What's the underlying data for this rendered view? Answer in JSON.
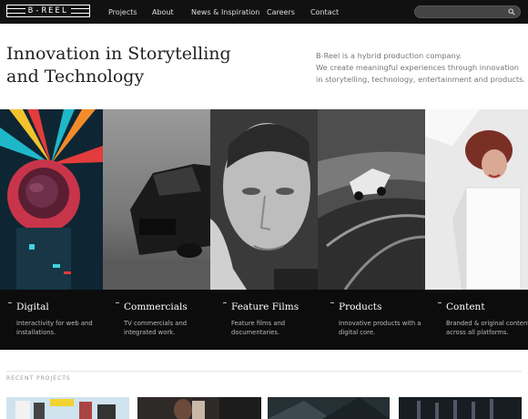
{
  "header": {
    "logo_text": "B-REEL",
    "nav": [
      "Projects",
      "About",
      "News & Inspiration",
      "Careers",
      "Contact"
    ],
    "search_placeholder": ""
  },
  "hero": {
    "title_line1": "Innovation in Storytelling",
    "title_line2": "and Technology",
    "desc_line1": "B-Reel is a hybrid production company.",
    "desc_line2": "We create meaningful experiences through innovation in storytelling, technology, entertainment and products."
  },
  "categories": [
    {
      "title": "Digital",
      "desc": "Interactivity for web and installations."
    },
    {
      "title": "Commercials",
      "desc": "TV commercials and integrated work."
    },
    {
      "title": "Feature Films",
      "desc": "Feature films and documentaries."
    },
    {
      "title": "Products",
      "desc": "Innovative products with a digital core."
    },
    {
      "title": "Content",
      "desc": "Branded & original content across all platforms."
    }
  ],
  "recent": {
    "label": "RECENT PROJECTS"
  },
  "colors": {
    "topbar": "#111111",
    "caption_bar": "#0c0c0c",
    "hero_text": "#222222",
    "desc_text": "#777777"
  }
}
